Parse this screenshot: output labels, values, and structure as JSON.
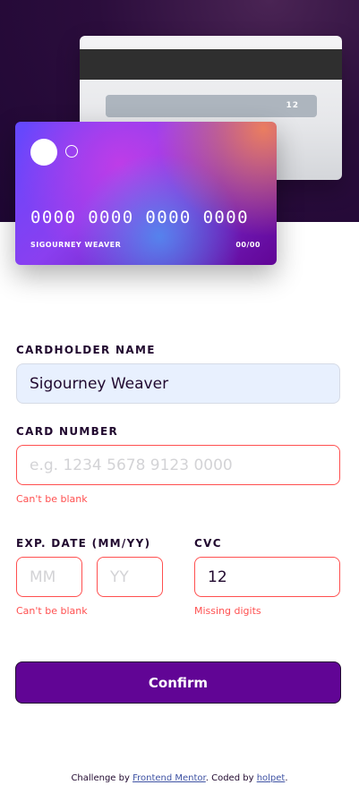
{
  "card": {
    "back_cvc": "12",
    "number": "0000 0000 0000 0000",
    "holder": "SIGOURNEY WEAVER",
    "expiry": "00/00"
  },
  "form": {
    "name": {
      "label": "CARDHOLDER NAME",
      "value": "Sigourney Weaver"
    },
    "number": {
      "label": "CARD NUMBER",
      "value": "",
      "placeholder": "e.g. 1234 5678 9123 0000",
      "error": "Can't be blank"
    },
    "expiry": {
      "label": "EXP. DATE (MM/YY)",
      "month_placeholder": "MM",
      "year_placeholder": "YY",
      "error": "Can't be blank"
    },
    "cvc": {
      "label": "CVC",
      "value": "12",
      "error": "Missing digits"
    },
    "confirm_label": "Confirm"
  },
  "footer": {
    "prefix": "Challenge by ",
    "link1": "Frontend Mentor",
    "middle": ". Coded by ",
    "link2": "holpet",
    "suffix": "."
  },
  "colors": {
    "accent": "#610595",
    "error": "#ff5050",
    "dark_text": "#21092f"
  }
}
